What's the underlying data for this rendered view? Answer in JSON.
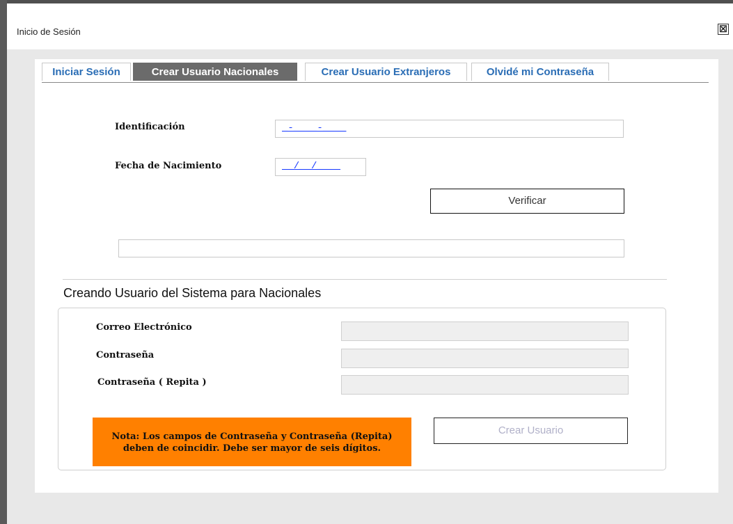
{
  "window": {
    "title": "Inicio de Sesión",
    "close_symbol": "☒"
  },
  "tabs": [
    {
      "label": "Iniciar Sesión",
      "active": false
    },
    {
      "label": "Crear Usuario Nacionales",
      "active": true
    },
    {
      "label": "Crear Usuario Extranjeros",
      "active": false
    },
    {
      "label": "Olvidé mi Contraseña",
      "active": false
    }
  ],
  "verify_form": {
    "identificacion_label": "Identificación",
    "identificacion_value": "_-____-____",
    "fecha_label": "Fecha de Nacimiento",
    "fecha_value": "__/__/____",
    "verify_button": "Verificar",
    "result_value": ""
  },
  "create_section": {
    "title": "Creando Usuario del Sistema para Nacionales",
    "email_label": "Correo Electrónico",
    "email_value": "",
    "password_label": "Contraseña",
    "password_value": "",
    "password_repeat_label": "Contraseña ( Repita )",
    "password_repeat_value": "",
    "note_line1": "Nota: Los campos de Contraseña y Contraseña (Repita)",
    "note_line2": "deben de coincidir. Debe ser mayor de seis dígitos.",
    "create_button": "Crear Usuario"
  },
  "colors": {
    "tab_text": "#2a6db5",
    "tab_active_bg": "#6b6b6b",
    "note_bg": "#ff8000",
    "mask_text": "#1a3cff"
  }
}
